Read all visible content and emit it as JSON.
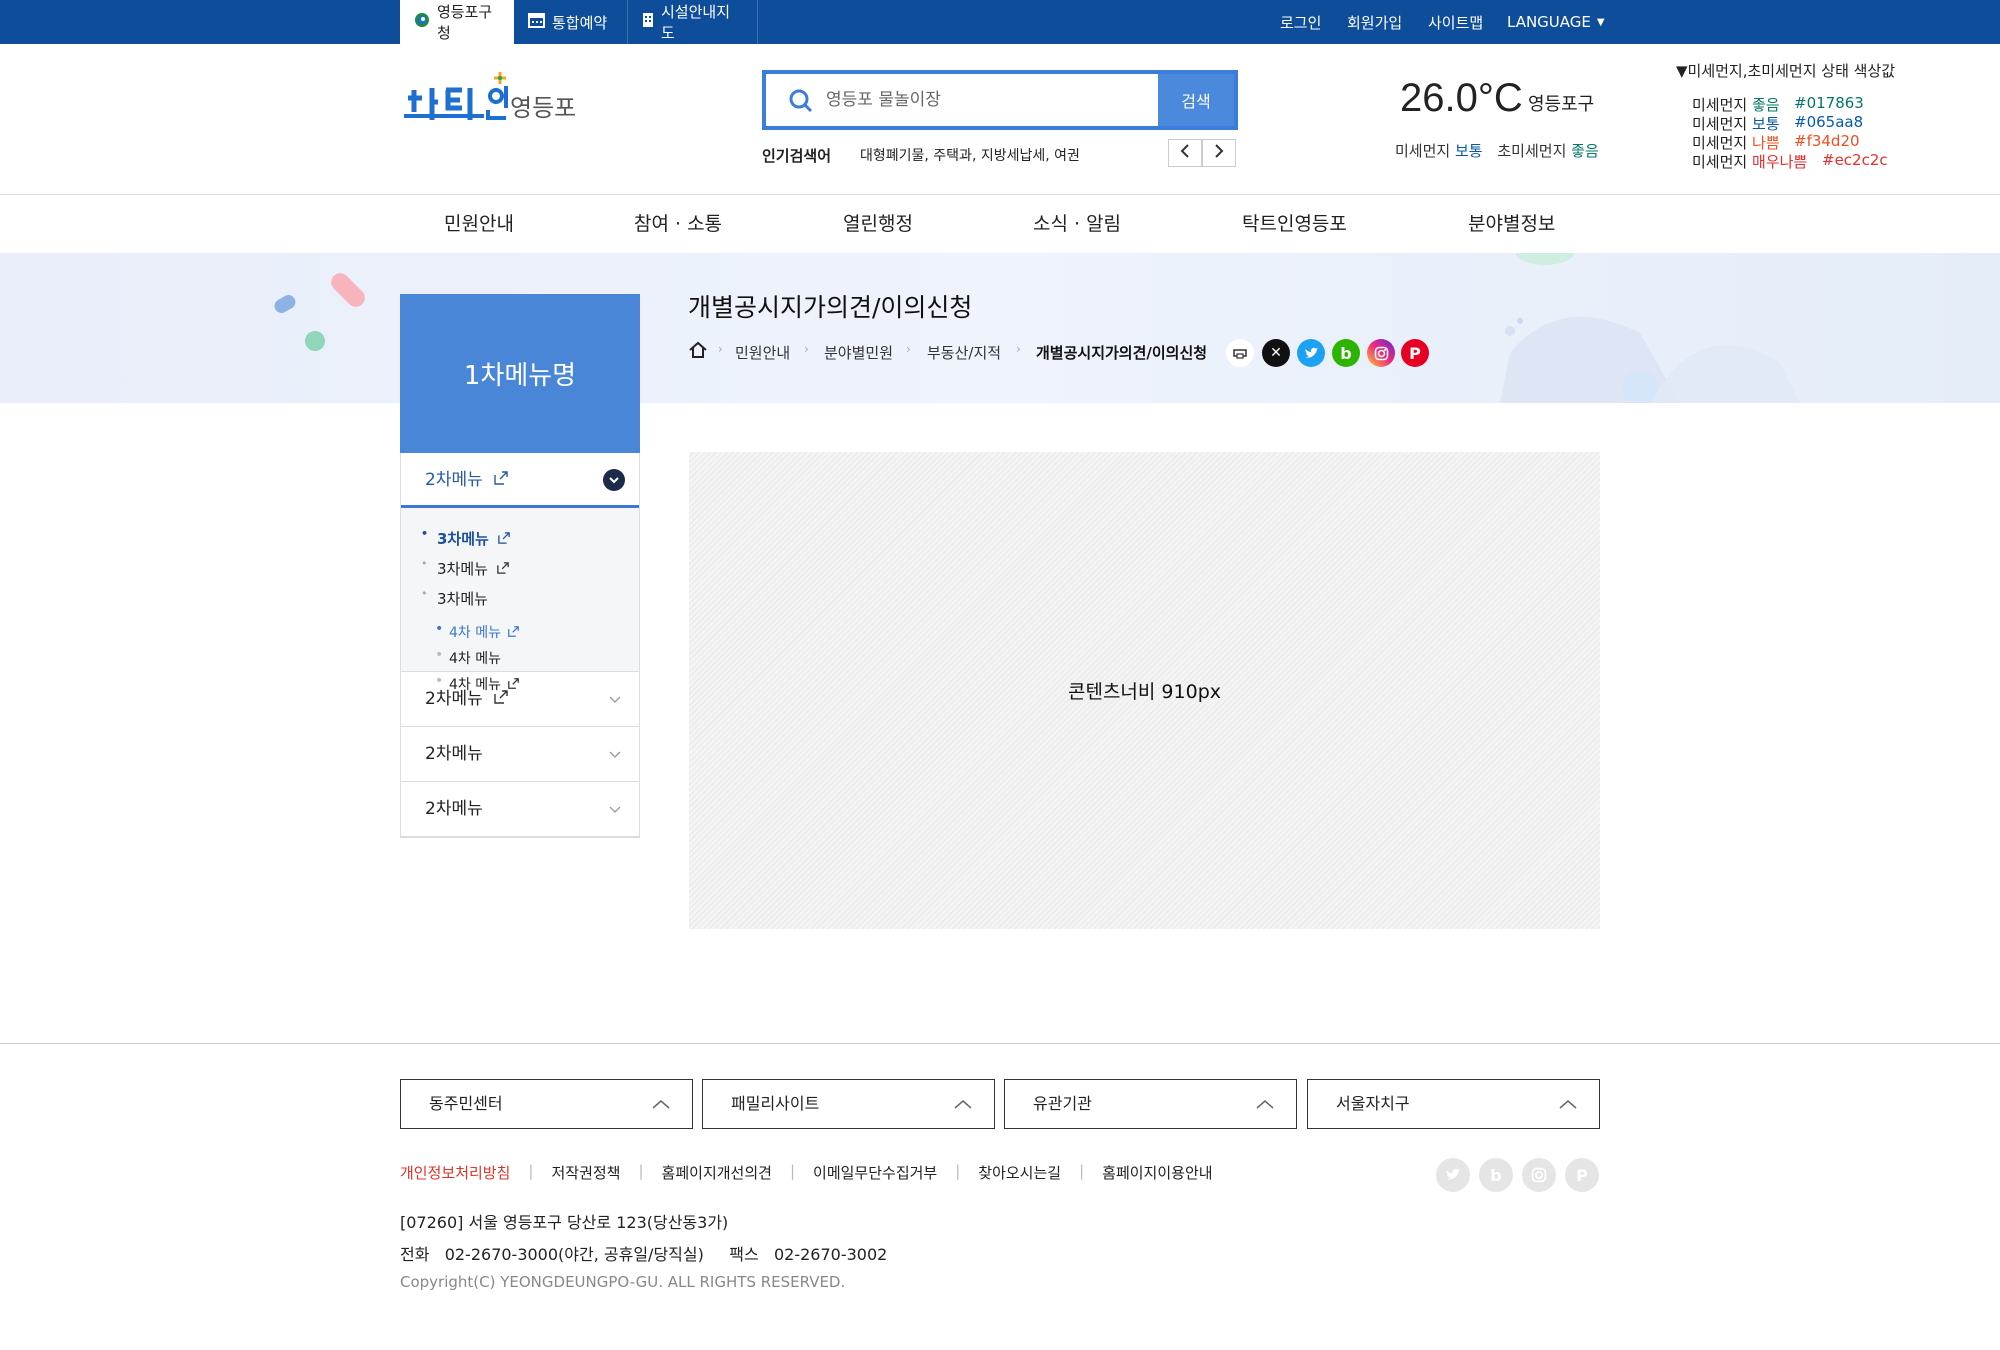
{
  "topbar": {
    "tabs": [
      {
        "label": "영등포구청",
        "icon": "yeongdeungpo-logo-icon"
      },
      {
        "label": "통합예약",
        "icon": "calendar-icon"
      },
      {
        "label": "시설안내지도",
        "icon": "building-map-icon"
      }
    ],
    "links": {
      "login": "로그인",
      "signup": "회원가입",
      "sitemap": "사이트맵",
      "language": "LANGUAGE"
    }
  },
  "header": {
    "logo_alt": "탁트인 영등포",
    "search": {
      "placeholder": "영등포 물놀이장",
      "button": "검색"
    },
    "popular": {
      "label": "인기검색어",
      "keywords": "대형폐기물, 주택과, 지방세납세, 여권"
    },
    "weather": {
      "temp": "26.0°C",
      "location": "영등포구",
      "dust_label": "미세먼지",
      "dust_value": "보통",
      "fine_dust_label": "초미세먼지",
      "fine_dust_value": "좋음"
    },
    "legend": {
      "title": "▼미세먼지,초미세먼지 상태 색상값",
      "rows": [
        {
          "prefix": "미세먼지",
          "status": "좋음",
          "code": "#017863",
          "color": "#017863"
        },
        {
          "prefix": "미세먼지",
          "status": "보통",
          "code": "#065aa8",
          "color": "#065aa8"
        },
        {
          "prefix": "미세먼지",
          "status": "나쁨",
          "code": "#f34d20",
          "color": "#f34d20"
        },
        {
          "prefix": "미세먼지",
          "status": "매우나쁨",
          "code": "#ec2c2c",
          "color": "#ec2c2c"
        }
      ]
    }
  },
  "gnb": [
    "민원안내",
    "참여 · 소통",
    "열린행정",
    "소식 · 알림",
    "탁트인영등포",
    "분야별정보"
  ],
  "page": {
    "title": "개별공시지가의견/이의신청",
    "breadcrumb": [
      "민원안내",
      "분야별민원",
      "부동산/지적",
      "개별공시지가의견/이의신청"
    ]
  },
  "lnb": {
    "title": "1차메뉴명",
    "open_item": "2차메뉴",
    "level3": [
      "3차메뉴",
      "3차메뉴",
      "3차메뉴"
    ],
    "level4": [
      "4차 메뉴",
      "4차 메뉴",
      "4차 메뉴"
    ],
    "closed_items": [
      "2차메뉴",
      "2차메뉴",
      "2차메뉴"
    ]
  },
  "content": {
    "placeholder": "콘텐츠너비 910px"
  },
  "footer": {
    "selects": [
      "동주민센터",
      "패밀리사이트",
      "유관기관",
      "서울자치구"
    ],
    "links": [
      "개인정보처리방침",
      "저작권정책",
      "홈페이지개선의견",
      "이메일무단수집거부",
      "찾아오시는길",
      "홈페이지이용안내"
    ],
    "address": "[07260] 서울 영등포구 당산로 123(당산동3가)",
    "phone": "전화   02-2670-3000(야간, 공휴일/당직실)     팩스   02-2670-3002",
    "copyright": "Copyright(C) YEONGDEUNGPO-GU. ALL RIGHTS RESERVED."
  },
  "colors": {
    "primary": "#0e4d99",
    "accent": "#4a86d8",
    "privacy_link": "#e0352b"
  }
}
